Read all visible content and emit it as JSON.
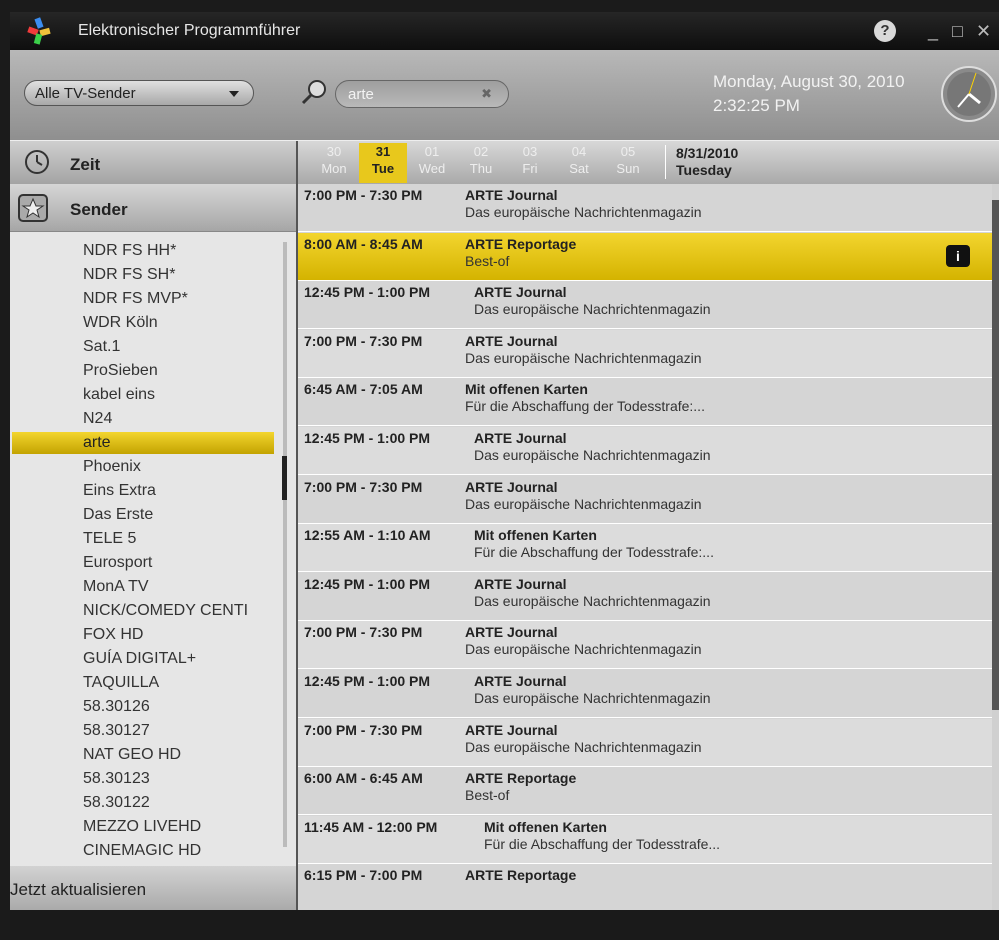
{
  "window": {
    "title": "Elektronischer Programmführer",
    "help": "?",
    "minimize": "_",
    "maximize": "□",
    "close": "✕"
  },
  "toolbar": {
    "channel_filter": "Alle TV-Sender",
    "search_value": "arte",
    "clear": "✖",
    "date": "Monday, August 30, 2010",
    "time": "2:32:25 PM"
  },
  "zeit": {
    "label": "Zeit"
  },
  "days": [
    {
      "num": "30",
      "name": "Mon",
      "selected": false
    },
    {
      "num": "31",
      "name": "Tue",
      "selected": true
    },
    {
      "num": "01",
      "name": "Wed",
      "selected": false
    },
    {
      "num": "02",
      "name": "Thu",
      "selected": false
    },
    {
      "num": "03",
      "name": "Fri",
      "selected": false
    },
    {
      "num": "04",
      "name": "Sat",
      "selected": false
    },
    {
      "num": "05",
      "name": "Sun",
      "selected": false
    }
  ],
  "current_date": {
    "date": "8/31/2010",
    "weekday": "Tuesday"
  },
  "sender": {
    "label": "Sender",
    "refresh": "Jetzt aktualisieren"
  },
  "channels": [
    "NDR FS HH*",
    "NDR FS SH*",
    "NDR FS MVP*",
    "WDR Köln",
    "Sat.1",
    "ProSieben",
    "kabel eins",
    "N24",
    "arte",
    "Phoenix",
    "Eins Extra",
    "Das Erste",
    "TELE 5",
    "Eurosport",
    "MonA TV",
    "NICK/COMEDY CENTI",
    "FOX HD",
    "GUÍA DIGITAL+",
    "TAQUILLA",
    "58.30126",
    "58.30127",
    "NAT GEO HD",
    "58.30123",
    "58.30122",
    "MEZZO LIVEHD",
    "CINEMAGIC HD"
  ],
  "selected_channel": "arte",
  "programs": [
    {
      "time": "7:00 PM - 7:30 PM",
      "title": "ARTE Journal",
      "subtitle": "Das europäische Nachrichtenmagazin"
    },
    {
      "time": "8:00 AM - 8:45 AM",
      "title": "ARTE Reportage",
      "subtitle": "Best-of",
      "selected": true,
      "info": "i"
    },
    {
      "time": "12:45 PM - 1:00 PM",
      "title": "ARTE Journal",
      "subtitle": "Das europäische Nachrichtenmagazin"
    },
    {
      "time": "7:00 PM - 7:30 PM",
      "title": "ARTE Journal",
      "subtitle": "Das europäische Nachrichtenmagazin"
    },
    {
      "time": "6:45 AM - 7:05 AM",
      "title": "Mit offenen Karten",
      "subtitle": "Für die Abschaffung der Todesstrafe:..."
    },
    {
      "time": "12:45 PM - 1:00 PM",
      "title": "ARTE Journal",
      "subtitle": "Das europäische Nachrichtenmagazin"
    },
    {
      "time": "7:00 PM - 7:30 PM",
      "title": "ARTE Journal",
      "subtitle": "Das europäische Nachrichtenmagazin"
    },
    {
      "time": "12:55 AM - 1:10 AM",
      "title": "Mit offenen Karten",
      "subtitle": "Für die Abschaffung der Todesstrafe:..."
    },
    {
      "time": "12:45 PM - 1:00 PM",
      "title": "ARTE Journal",
      "subtitle": "Das europäische Nachrichtenmagazin"
    },
    {
      "time": "7:00 PM - 7:30 PM",
      "title": "ARTE Journal",
      "subtitle": "Das europäische Nachrichtenmagazin"
    },
    {
      "time": "12:45 PM - 1:00 PM",
      "title": "ARTE Journal",
      "subtitle": "Das europäische Nachrichtenmagazin"
    },
    {
      "time": "7:00 PM - 7:30 PM",
      "title": "ARTE Journal",
      "subtitle": "Das europäische Nachrichtenmagazin"
    },
    {
      "time": "6:00 AM - 6:45 AM",
      "title": "ARTE Reportage",
      "subtitle": "Best-of"
    },
    {
      "time": "11:45 AM - 12:00 PM",
      "title": "Mit offenen Karten",
      "subtitle": "Für die Abschaffung der Todesstrafe..."
    },
    {
      "time": "6:15 PM - 7:00 PM",
      "title": "ARTE Reportage",
      "subtitle": ""
    }
  ],
  "colors": {
    "accent": "#e8c81c"
  }
}
